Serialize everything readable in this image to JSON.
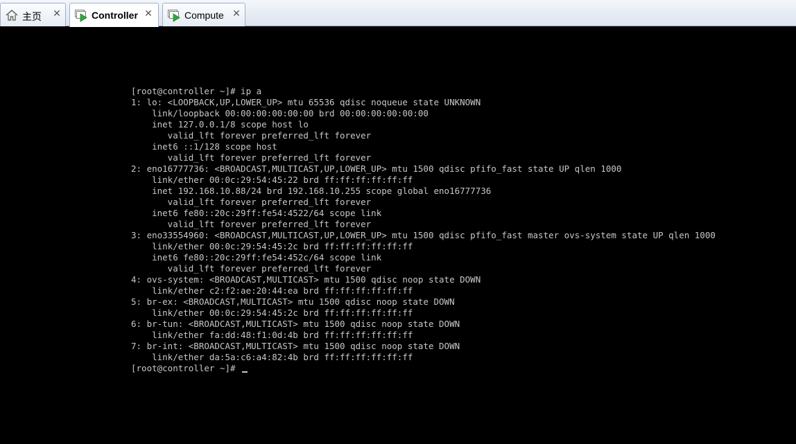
{
  "tabs": [
    {
      "label": "主页",
      "icon": "home-icon",
      "active": false
    },
    {
      "label": "Controller",
      "icon": "vm-running-icon",
      "active": true
    },
    {
      "label": "Compute",
      "icon": "vm-running-icon",
      "active": false
    }
  ],
  "colors": {
    "console_bg": "#000000",
    "console_text": "#c7c7c7",
    "vm_icon_green": "#2fa83a"
  },
  "terminal": {
    "lines": [
      "[root@controller ~]# ip a",
      "1: lo: <LOOPBACK,UP,LOWER_UP> mtu 65536 qdisc noqueue state UNKNOWN",
      "    link/loopback 00:00:00:00:00:00 brd 00:00:00:00:00:00",
      "    inet 127.0.0.1/8 scope host lo",
      "       valid_lft forever preferred_lft forever",
      "    inet6 ::1/128 scope host",
      "       valid_lft forever preferred_lft forever",
      "2: eno16777736: <BROADCAST,MULTICAST,UP,LOWER_UP> mtu 1500 qdisc pfifo_fast state UP qlen 1000",
      "    link/ether 00:0c:29:54:45:22 brd ff:ff:ff:ff:ff:ff",
      "    inet 192.168.10.88/24 brd 192.168.10.255 scope global eno16777736",
      "       valid_lft forever preferred_lft forever",
      "    inet6 fe80::20c:29ff:fe54:4522/64 scope link",
      "       valid_lft forever preferred_lft forever",
      "3: eno33554960: <BROADCAST,MULTICAST,UP,LOWER_UP> mtu 1500 qdisc pfifo_fast master ovs-system state UP qlen 1000",
      "    link/ether 00:0c:29:54:45:2c brd ff:ff:ff:ff:ff:ff",
      "    inet6 fe80::20c:29ff:fe54:452c/64 scope link",
      "       valid_lft forever preferred_lft forever",
      "4: ovs-system: <BROADCAST,MULTICAST> mtu 1500 qdisc noop state DOWN",
      "    link/ether c2:f2:ae:20:44:ea brd ff:ff:ff:ff:ff:ff",
      "5: br-ex: <BROADCAST,MULTICAST> mtu 1500 qdisc noop state DOWN",
      "    link/ether 00:0c:29:54:45:2c brd ff:ff:ff:ff:ff:ff",
      "6: br-tun: <BROADCAST,MULTICAST> mtu 1500 qdisc noop state DOWN",
      "    link/ether fa:dd:48:f1:0d:4b brd ff:ff:ff:ff:ff:ff",
      "7: br-int: <BROADCAST,MULTICAST> mtu 1500 qdisc noop state DOWN",
      "    link/ether da:5a:c6:a4:82:4b brd ff:ff:ff:ff:ff:ff"
    ],
    "prompt": "[root@controller ~]# "
  }
}
